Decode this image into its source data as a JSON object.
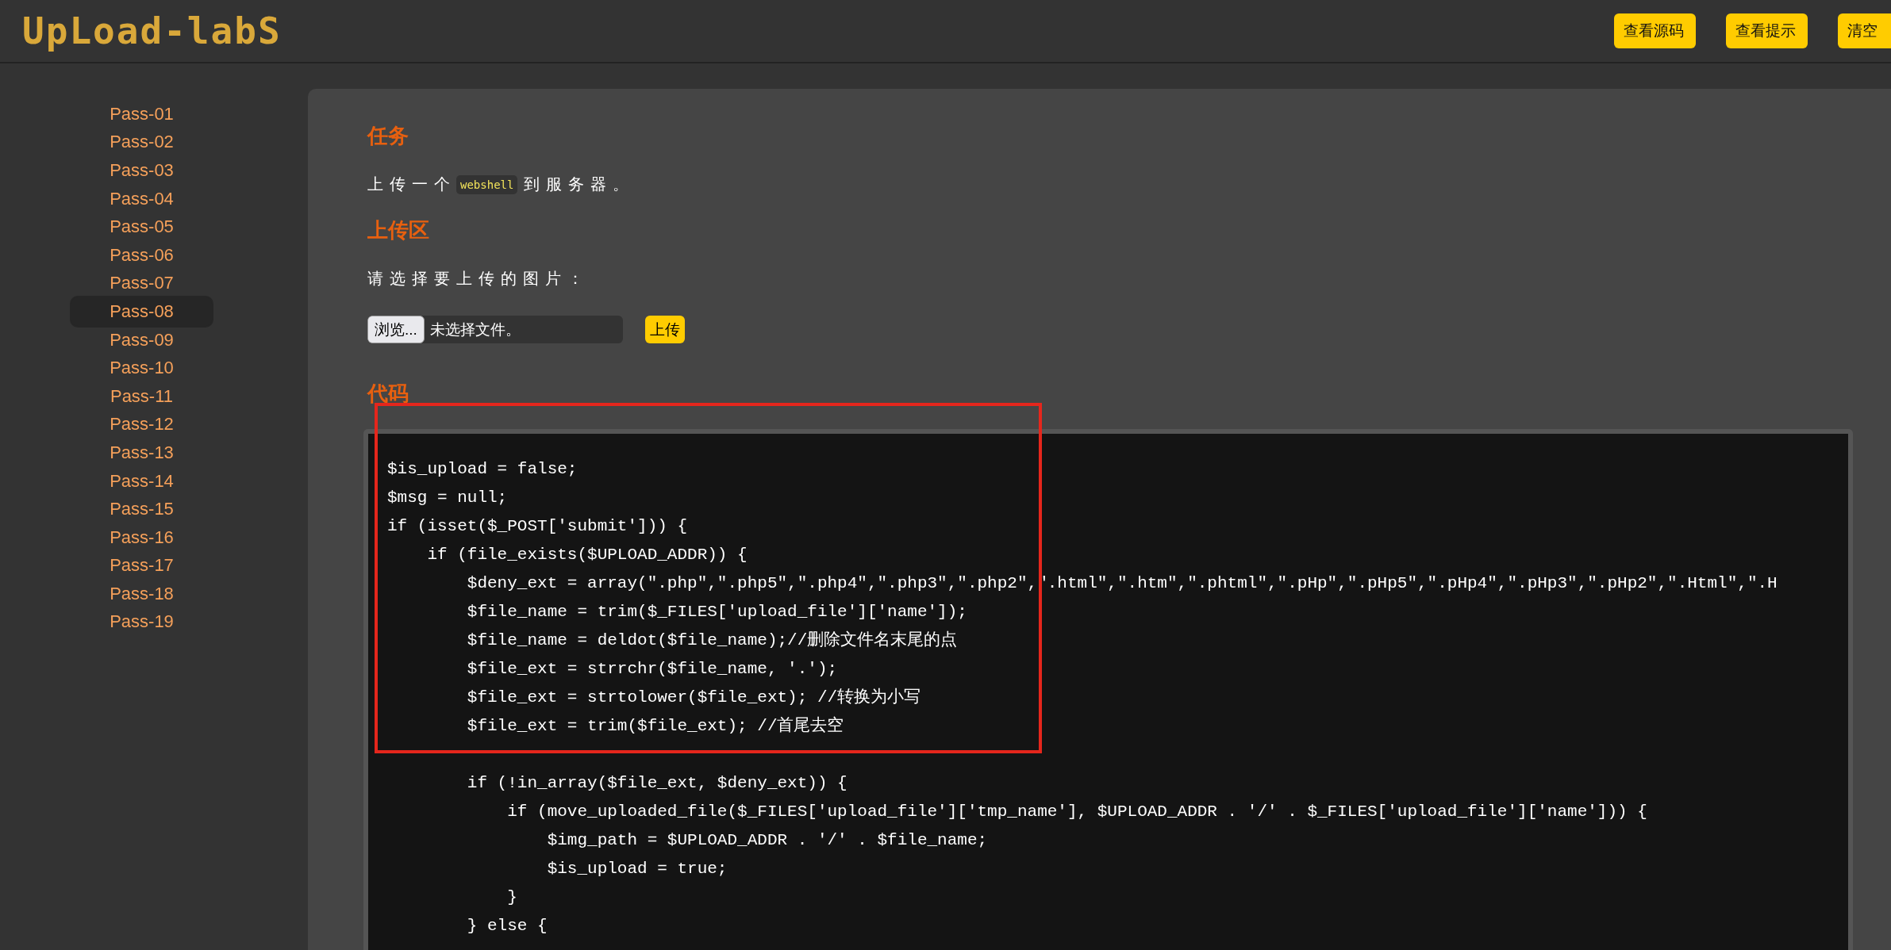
{
  "header": {
    "logo": "UpLoad-labS",
    "buttons": [
      {
        "label": "查看源码"
      },
      {
        "label": "查看提示"
      },
      {
        "label": "清空"
      }
    ]
  },
  "sidebar": {
    "items": [
      {
        "label": "Pass-01",
        "selected": false
      },
      {
        "label": "Pass-02",
        "selected": false
      },
      {
        "label": "Pass-03",
        "selected": false
      },
      {
        "label": "Pass-04",
        "selected": false
      },
      {
        "label": "Pass-05",
        "selected": false
      },
      {
        "label": "Pass-06",
        "selected": false
      },
      {
        "label": "Pass-07",
        "selected": false
      },
      {
        "label": "Pass-08",
        "selected": true
      },
      {
        "label": "Pass-09",
        "selected": false
      },
      {
        "label": "Pass-10",
        "selected": false
      },
      {
        "label": "Pass-11",
        "selected": false
      },
      {
        "label": "Pass-12",
        "selected": false
      },
      {
        "label": "Pass-13",
        "selected": false
      },
      {
        "label": "Pass-14",
        "selected": false
      },
      {
        "label": "Pass-15",
        "selected": false
      },
      {
        "label": "Pass-16",
        "selected": false
      },
      {
        "label": "Pass-17",
        "selected": false
      },
      {
        "label": "Pass-18",
        "selected": false
      },
      {
        "label": "Pass-19",
        "selected": false
      }
    ]
  },
  "task": {
    "heading": "任务",
    "before": "上传一个",
    "code": "webshell",
    "after": "到服务器。"
  },
  "upload": {
    "heading": "上传区",
    "prompt": "请选择要上传的图片：",
    "browse_button": "浏览...",
    "file_status": "未选择文件。",
    "submit_button": "上传"
  },
  "code_section": {
    "heading": "代码",
    "code": "$is_upload = false;\n$msg = null;\nif (isset($_POST['submit'])) {\n    if (file_exists($UPLOAD_ADDR)) {\n        $deny_ext = array(\".php\",\".php5\",\".php4\",\".php3\",\".php2\",\".html\",\".htm\",\".phtml\",\".pHp\",\".pHp5\",\".pHp4\",\".pHp3\",\".pHp2\",\".Html\",\".H\n        $file_name = trim($_FILES['upload_file']['name']);\n        $file_name = deldot($file_name);//删除文件名末尾的点\n        $file_ext = strrchr($file_name, '.');\n        $file_ext = strtolower($file_ext); //转换为小写\n        $file_ext = trim($file_ext); //首尾去空\n\n        if (!in_array($file_ext, $deny_ext)) {\n            if (move_uploaded_file($_FILES['upload_file']['tmp_name'], $UPLOAD_ADDR . '/' . $_FILES['upload_file']['name'])) {\n                $img_path = $UPLOAD_ADDR . '/' . $file_name;\n                $is_upload = true;\n            }\n        } else {"
  },
  "annotations": [
    {
      "kind": "box"
    }
  ]
}
